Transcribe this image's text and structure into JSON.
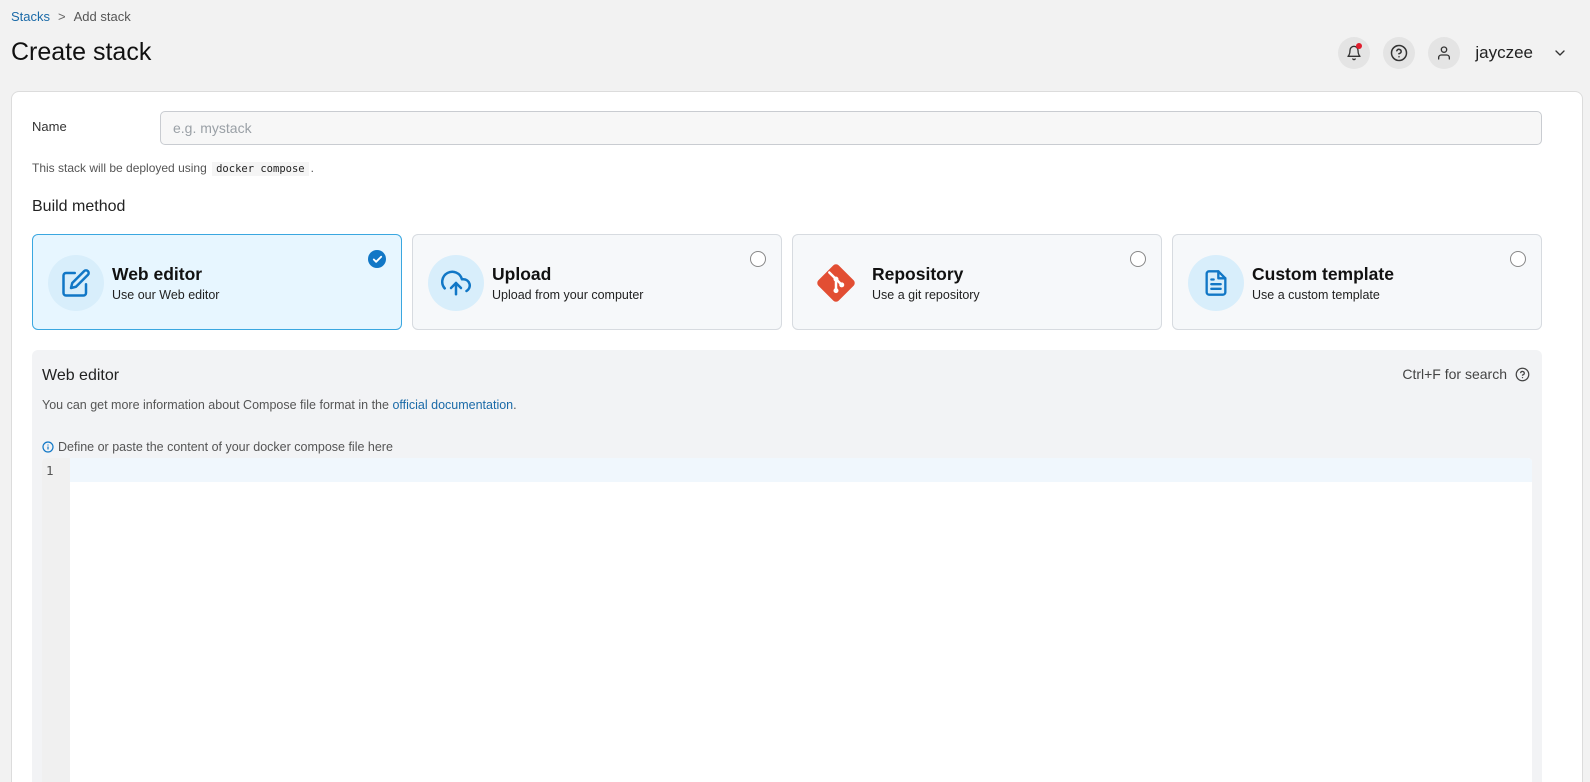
{
  "breadcrumb": {
    "parent": "Stacks",
    "separator": ">",
    "current": "Add stack"
  },
  "page_title": "Create stack",
  "header": {
    "username": "jayczee"
  },
  "form": {
    "name_label": "Name",
    "name_placeholder": "e.g. mystack",
    "name_value": "",
    "deploy_note_prefix": "This stack will be deployed using",
    "deploy_note_code": "docker compose",
    "deploy_note_suffix": "."
  },
  "build_method": {
    "title": "Build method",
    "selected": "web-editor",
    "options": [
      {
        "id": "web-editor",
        "title": "Web editor",
        "subtitle": "Use our Web editor",
        "icon": "edit-icon"
      },
      {
        "id": "upload",
        "title": "Upload",
        "subtitle": "Upload from your computer",
        "icon": "cloud-upload-icon"
      },
      {
        "id": "repository",
        "title": "Repository",
        "subtitle": "Use a git repository",
        "icon": "git-icon"
      },
      {
        "id": "custom-template",
        "title": "Custom template",
        "subtitle": "Use a custom template",
        "icon": "file-text-icon"
      }
    ]
  },
  "editor": {
    "title": "Web editor",
    "search_hint": "Ctrl+F for search",
    "info_prefix": "You can get more information about Compose file format in the",
    "info_link": "official documentation",
    "info_suffix": ".",
    "hint": "Define or paste the content of your docker compose file here",
    "line_number": "1"
  },
  "colors": {
    "accent": "#1177c6",
    "selected_bg": "#e7f6ff",
    "git": "#e24e33",
    "link": "#1a6aa8"
  }
}
